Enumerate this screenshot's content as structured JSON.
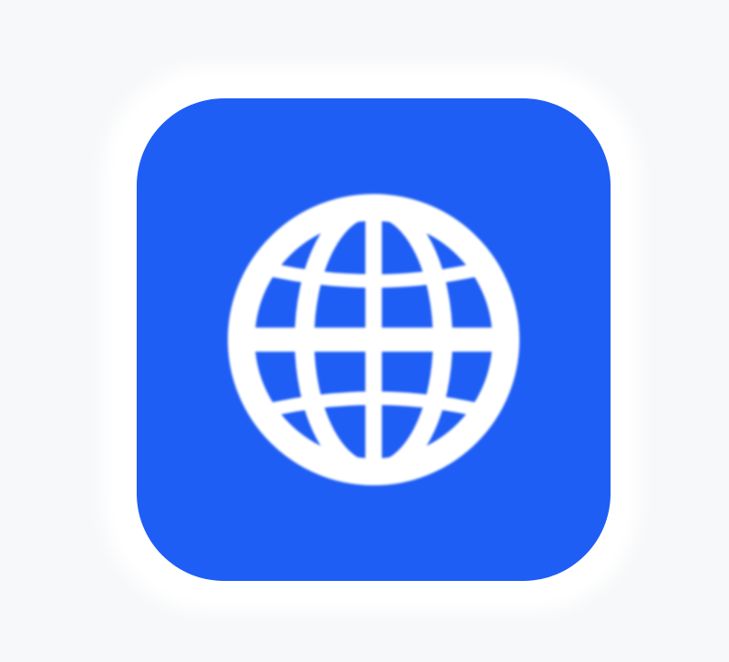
{
  "app_icon": {
    "icon": "globe-icon",
    "background_color": "#1f5ef5",
    "glyph_color": "#ffffff",
    "halo_color": "#ffffff"
  }
}
